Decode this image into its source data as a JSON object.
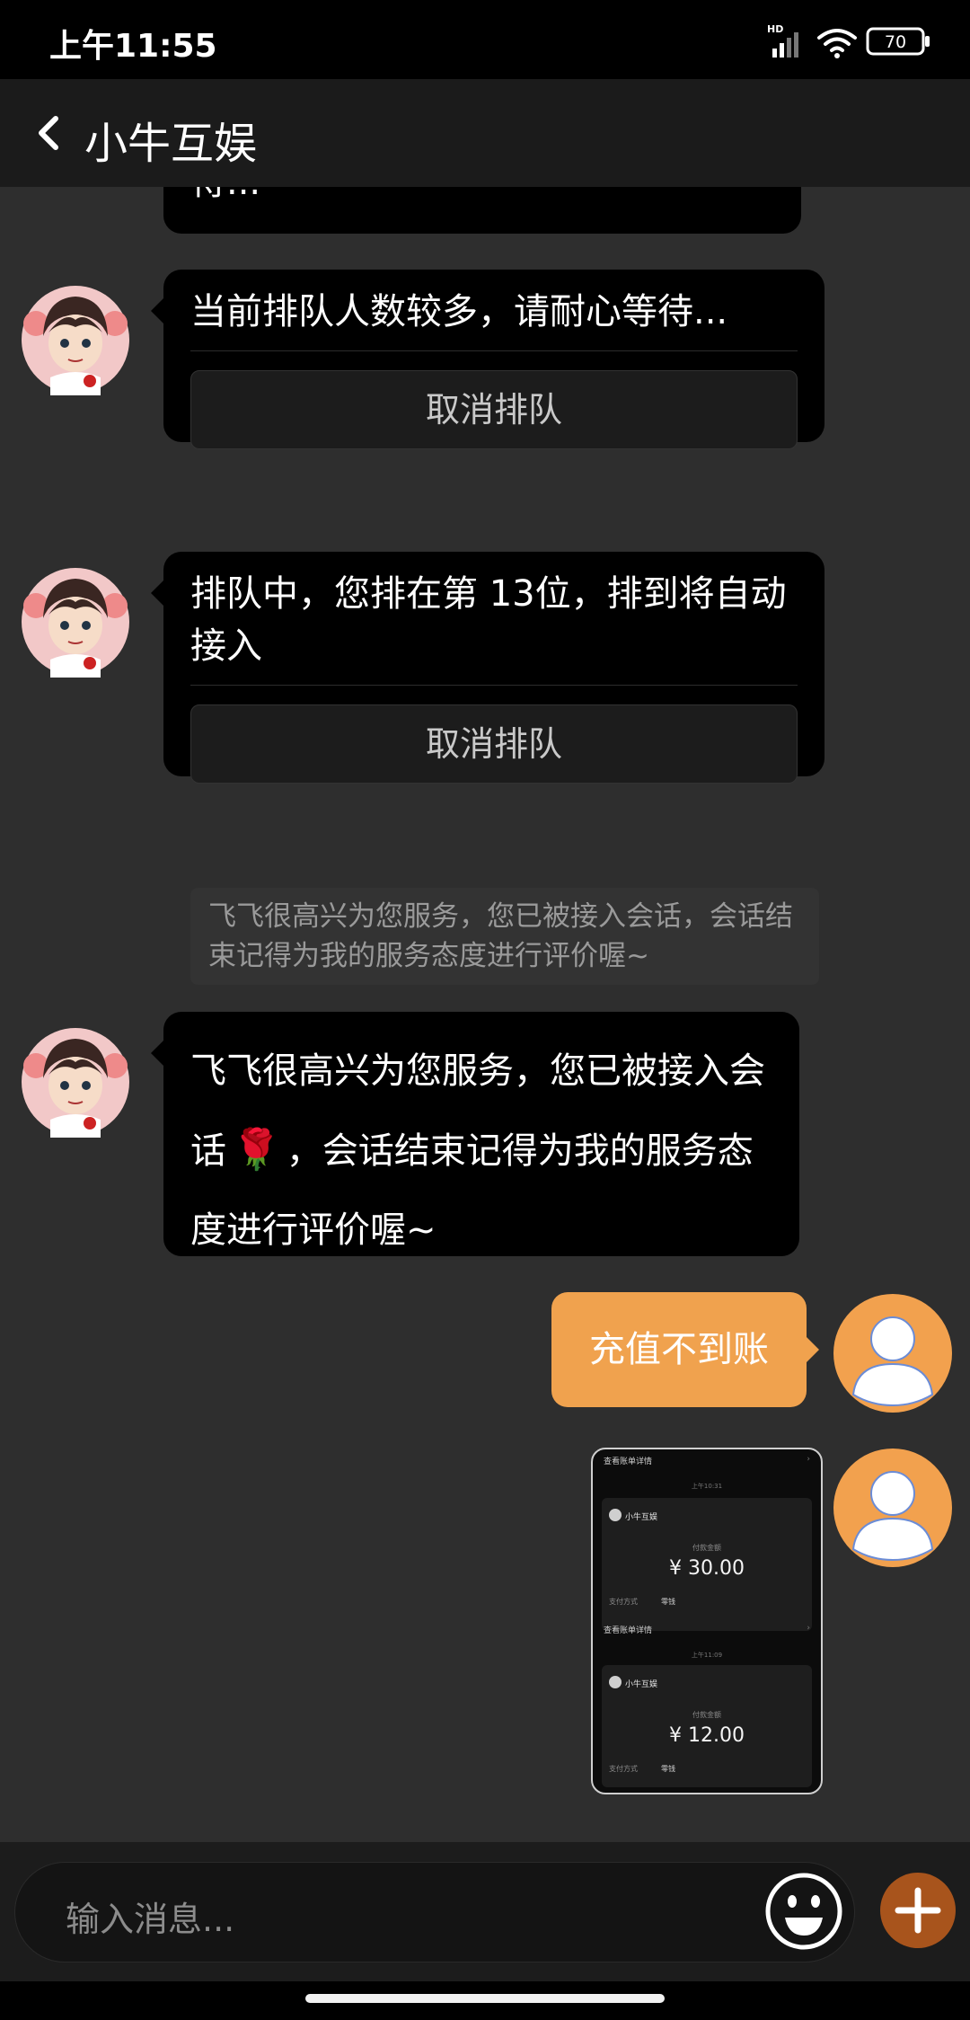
{
  "status_bar": {
    "time": "上午11:55",
    "network_label": "HD",
    "battery": "70"
  },
  "header": {
    "title": "小牛互娱"
  },
  "messages": {
    "partial_text": "待...",
    "queue_busy_text": "当前排队人数较多，请耐心等待...",
    "queue_busy_cancel": "取消排队",
    "queue_position_text": "排队中，您排在第 13位，排到将自动接入",
    "queue_position_cancel": "取消排队",
    "system_notice": "飞飞很高兴为您服务，您已被接入会话，会话结束记得为我的服务态度进行评价喔~",
    "agent_greeting_part1": "飞飞很高兴为您服务，您已被接入会话",
    "agent_greeting_emoji": "🌹",
    "agent_greeting_part2": "，会话结束记得为我的服务态度进行评价喔~",
    "user_text": "充值不到账"
  },
  "screenshot_thumb": {
    "bill_link": "查看账单详情",
    "time1": "上午10:31",
    "merchant1": "小牛互娱",
    "amount_label1": "付款金额",
    "amount1": "¥ 30.00",
    "pay_method_label1": "支付方式",
    "pay_method1": "零钱",
    "bill_link2": "查看账单详情",
    "time2": "上午11:09",
    "merchant2": "小牛互娱",
    "amount_label2": "付款金额",
    "amount2": "¥ 12.00",
    "pay_method_label2": "支付方式",
    "pay_method2": "零钱"
  },
  "input": {
    "placeholder": "输入消息..."
  },
  "colors": {
    "background": "#2e2e2e",
    "bubble_dark": "#000000",
    "user_bubble": "#f0a24e",
    "plus_button": "#a8541c"
  },
  "icons": {
    "back": "chevron-left-icon",
    "emoji": "smiley-icon",
    "plus": "plus-icon",
    "user_avatar": "user-silhouette-icon"
  }
}
